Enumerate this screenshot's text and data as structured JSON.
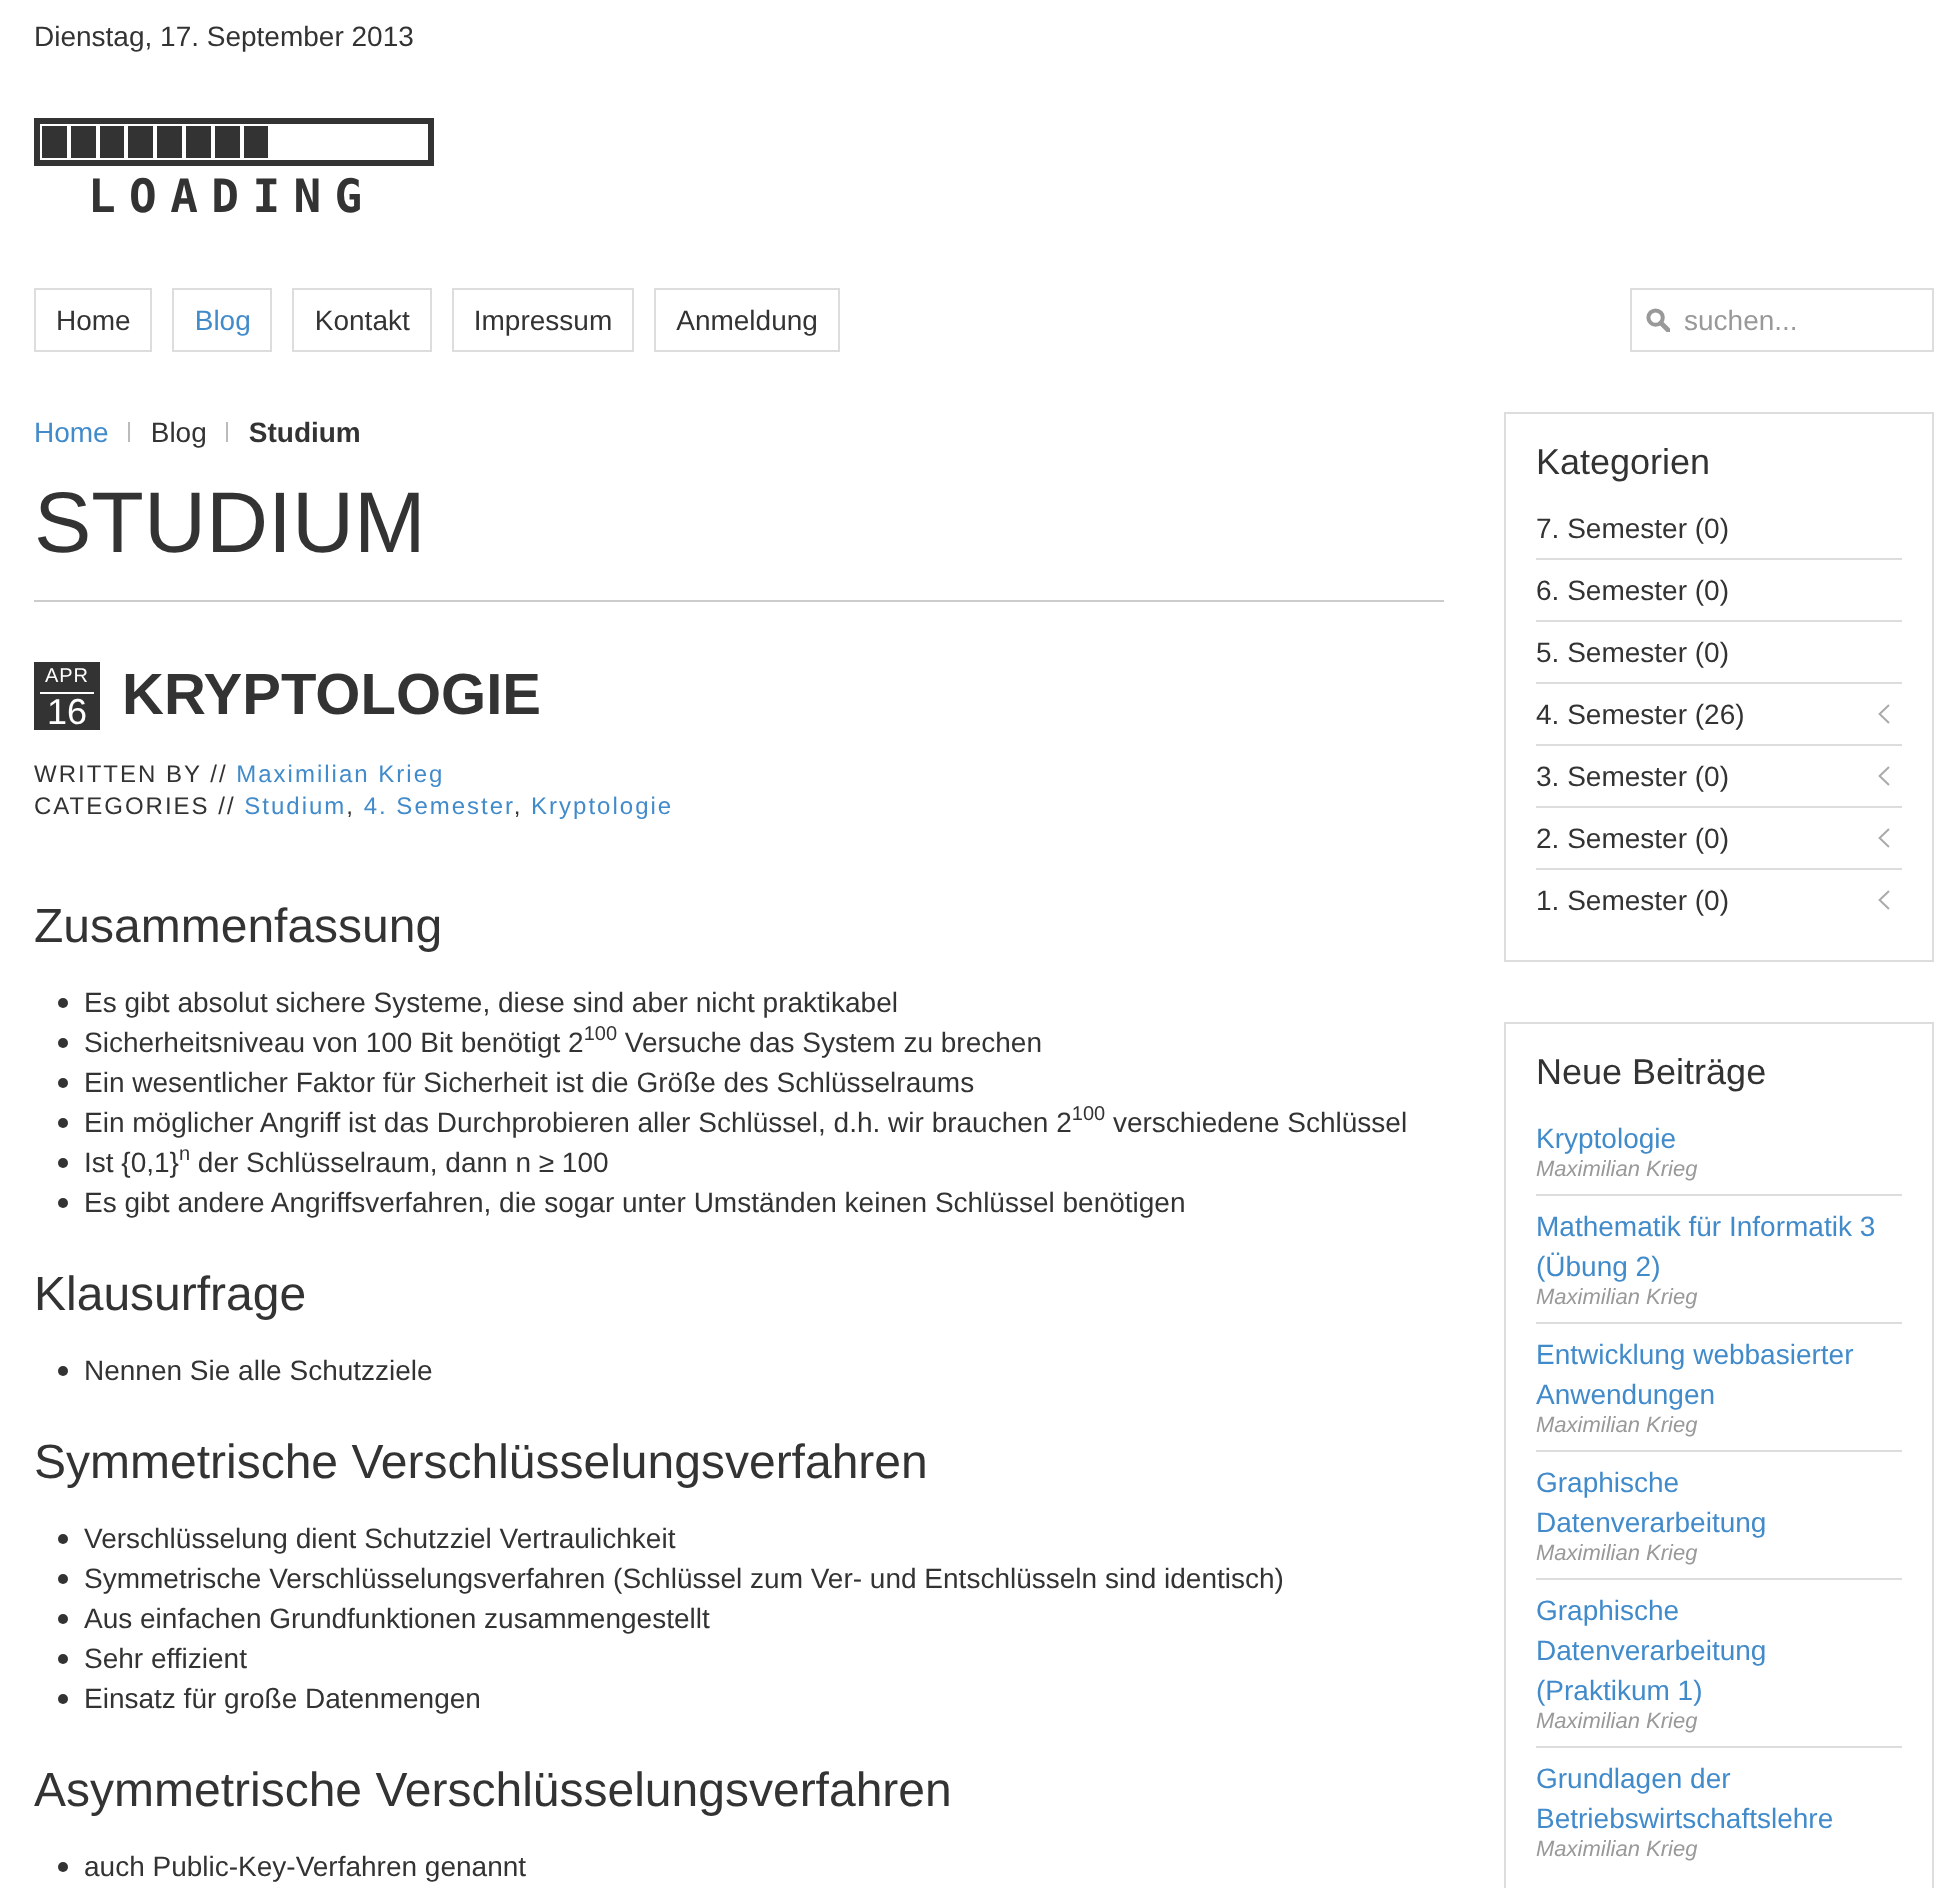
{
  "date": "Dienstag, 17. September 2013",
  "logo": {
    "text": "LOADING",
    "level": 0.6
  },
  "nav": [
    {
      "label": "Home",
      "selected": false
    },
    {
      "label": "Blog",
      "selected": true
    },
    {
      "label": "Kontakt",
      "selected": false
    },
    {
      "label": "Impressum",
      "selected": false
    },
    {
      "label": "Anmeldung",
      "selected": false
    }
  ],
  "search": {
    "placeholder": "suchen..."
  },
  "breadcrumb": [
    {
      "label": "Home",
      "kind": "link"
    },
    {
      "label": "Blog",
      "kind": "text"
    },
    {
      "label": "Studium",
      "kind": "current"
    }
  ],
  "page_title": "STUDIUM",
  "post": {
    "month": "APR",
    "day": "16",
    "title": "KRYPTOLOGIE",
    "written_by_label": "WRITTEN BY //",
    "author": "Maximilian Krieg",
    "categories_label": "CATEGORIES //",
    "categories": [
      {
        "label": "Studium",
        "after": ","
      },
      {
        "label": "4. Semester",
        "after": ","
      },
      {
        "label": "Kryptologie"
      }
    ]
  },
  "sections": [
    {
      "heading": "Zusammenfassung",
      "items": [
        "Es gibt absolut sichere Systeme, diese sind aber nicht praktikabel",
        "Sicherheitsniveau von 100 Bit benötigt 2$^{100}$ Versuche das System zu brechen",
        "Ein wesentlicher Faktor für Sicherheit ist die Größe des Schlüsselraums",
        "Ein möglicher Angriff ist das Durchprobieren aller Schlüssel, d.h. wir brauchen 2$^{100}$ verschiedene Schlüssel",
        "Ist {0,1}$^{n}$ der Schlüsselraum, dann n ≥ 100",
        "Es gibt andere Angriffsverfahren, die sogar unter Umständen keinen Schlüssel benötigen"
      ]
    },
    {
      "heading": "Klausurfrage",
      "items": [
        "Nennen Sie alle Schutzziele"
      ]
    },
    {
      "heading": "Symmetrische Verschlüsselungsverfahren",
      "items": [
        "Verschlüsselung dient Schutzziel Vertraulichkeit",
        "Symmetrische Verschlüsselungsverfahren (Schlüssel zum Ver- und Entschlüsseln sind identisch)",
        "Aus einfachen Grundfunktionen zusammengestellt",
        "Sehr effizient",
        "Einsatz für große Datenmengen"
      ]
    },
    {
      "heading": "Asymmetrische Verschlüsselungsverfahren",
      "items": [
        "auch Public-Key-Verfahren genannt"
      ]
    }
  ],
  "sidebar": {
    "categories": {
      "title": "Kategorien",
      "items": [
        {
          "label": "7. Semester (0)",
          "expandable": false
        },
        {
          "label": "6. Semester (0)",
          "expandable": false
        },
        {
          "label": "5. Semester (0)",
          "expandable": false
        },
        {
          "label": "4. Semester (26)",
          "expandable": true
        },
        {
          "label": "3. Semester (0)",
          "expandable": true
        },
        {
          "label": "2. Semester (0)",
          "expandable": true
        },
        {
          "label": "1. Semester (0)",
          "expandable": true
        }
      ]
    },
    "recent_posts": {
      "title": "Neue Beiträge",
      "items": [
        {
          "title": "Kryptologie",
          "author": "Maximilian Krieg"
        },
        {
          "title": "Mathematik für Informatik 3 (Übung 2)",
          "author": "Maximilian Krieg"
        },
        {
          "title": "Entwicklung webbasierter Anwendungen",
          "author": "Maximilian Krieg"
        },
        {
          "title": "Graphische Datenverarbeitung",
          "author": "Maximilian Krieg"
        },
        {
          "title": "Graphische Datenverarbeitung (Praktikum 1)",
          "author": "Maximilian Krieg"
        },
        {
          "title": "Grundlagen der Betriebswirtschaftslehre",
          "author": "Maximilian Krieg"
        }
      ]
    }
  }
}
